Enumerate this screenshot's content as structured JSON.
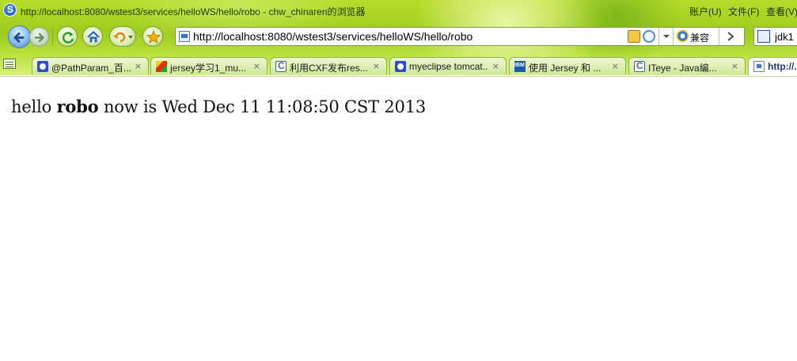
{
  "window": {
    "title": "http://localhost:8080/wstest3/services/helloWS/hello/robo - chw_chinaren的浏览器",
    "menus": [
      "账户(U)",
      "文件(F)",
      "查看(V)"
    ]
  },
  "navbar": {
    "address": "http://localhost:8080/wstest3/services/helloWS/hello/robo",
    "compat_label": "兼容",
    "search_value": "jdk1"
  },
  "tabs": [
    {
      "label": "@PathParam_百...",
      "favicon": "baidu-icon"
    },
    {
      "label": "jersey学习1_mu...",
      "favicon": "csdn-icon"
    },
    {
      "label": "利用CXF发布res...",
      "favicon": "c-icon"
    },
    {
      "label": "myeclipse tomcat...",
      "favicon": "baidu-icon"
    },
    {
      "label": "使用 Jersey 和 ...",
      "favicon": "ibm-icon"
    },
    {
      "label": "ITeye - Java编...",
      "favicon": "c-icon"
    },
    {
      "label": "http://...",
      "favicon": "page-icon",
      "active": true
    }
  ],
  "tab_close_glyph": "×",
  "content": {
    "prefix": "hello ",
    "name": "robo",
    "suffix": " now is Wed Dec 11 11:08:50 CST 2013"
  },
  "colors": {
    "chrome_green": "#9ecb1c",
    "tab_border": "#8cb24a"
  }
}
